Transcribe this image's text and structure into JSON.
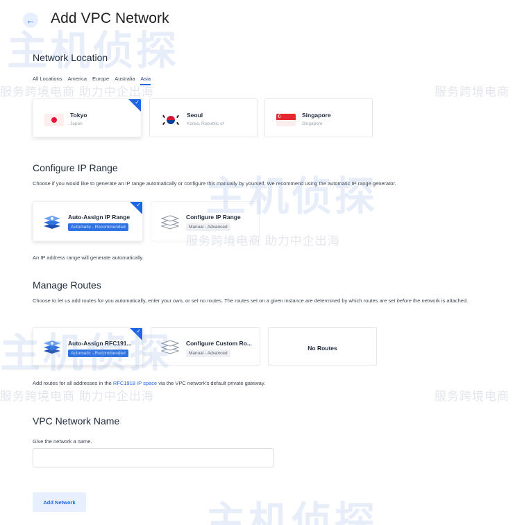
{
  "header": {
    "title": "Add VPC Network",
    "back_icon": "←"
  },
  "network_location": {
    "title": "Network Location",
    "tabs": [
      {
        "label": "All Locations",
        "active": false
      },
      {
        "label": "America",
        "active": false
      },
      {
        "label": "Europe",
        "active": false
      },
      {
        "label": "Australia",
        "active": false
      },
      {
        "label": "Asia",
        "active": true
      }
    ],
    "locations": [
      {
        "name": "Tokyo",
        "country": "Japan",
        "flag": "flag-japan",
        "selected": true
      },
      {
        "name": "Seoul",
        "country": "Korea, Republic of",
        "flag": "flag-korea",
        "selected": false
      },
      {
        "name": "Singapore",
        "country": "Singapore",
        "flag": "flag-singapore",
        "selected": false
      }
    ]
  },
  "ip_range": {
    "title": "Configure IP Range",
    "description": "Choose if you would like to generate an IP range automatically or configure this manually by yourself. We recommend using the automatic IP range generator.",
    "options": [
      {
        "name": "Auto-Assign IP Range",
        "badge": "Automatic - Recommended",
        "selected": true
      },
      {
        "name": "Configure IP Range",
        "badge": "Manual - Advanced",
        "selected": false
      }
    ],
    "note": "An IP address range will generate automatically."
  },
  "routes": {
    "title": "Manage Routes",
    "description_part1": "Choose to let us add routes for you automatically, enter your own, or set no routes. The routes set on a given instance are determined by which routes are set ",
    "description_emph": "before",
    "description_part2": " the network is attached.",
    "options": [
      {
        "name": "Auto-Assign RFC191...",
        "badge": "Automatic - Recommended",
        "selected": true
      },
      {
        "name": "Configure Custom Ro...",
        "badge": "Manual - Advanced",
        "selected": false
      },
      {
        "name": "No Routes",
        "selected": false
      }
    ],
    "note_part1": "Add routes for all addresses in the ",
    "note_link": "RFC1918 IP space",
    "note_part2": " via the VPC network's default private gateway."
  },
  "vpc_name": {
    "title": "VPC Network Name",
    "label": "Give the network a name.",
    "value": "",
    "placeholder": ""
  },
  "submit": {
    "label": "Add Network"
  },
  "watermark": {
    "brand": "主机侦探",
    "slogan": "服务跨境电商 助力中企出海",
    "slogan_short": "服务跨境电商"
  },
  "colors": {
    "accent": "#1e66e6",
    "badge_recommended": "#2e73e0"
  }
}
